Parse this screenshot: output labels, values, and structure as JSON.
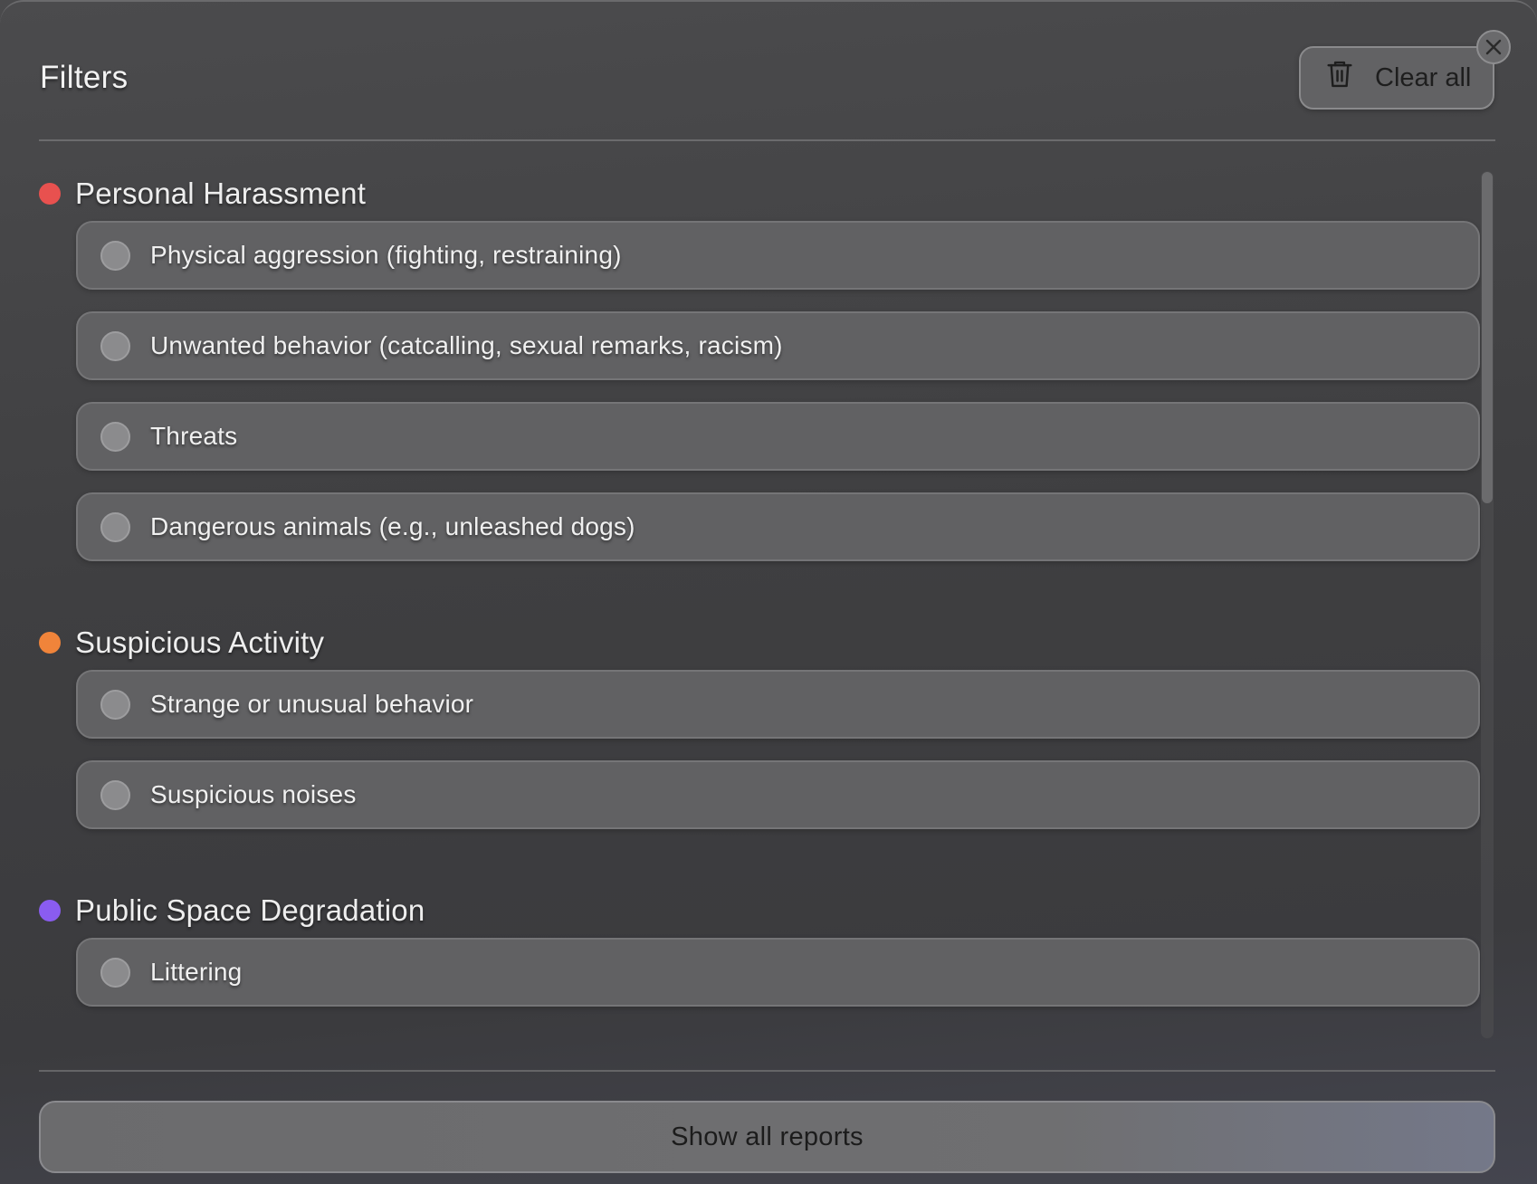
{
  "header": {
    "title": "Filters",
    "clear_all_label": "Clear all"
  },
  "sections": [
    {
      "title": "Personal Harassment",
      "color": "#e8514f",
      "options": [
        "Physical aggression (fighting, restraining)",
        "Unwanted behavior (catcalling, sexual remarks, racism)",
        "Threats",
        "Dangerous animals (e.g., unleashed dogs)"
      ]
    },
    {
      "title": "Suspicious Activity",
      "color": "#f0843a",
      "options": [
        "Strange or unusual behavior",
        "Suspicious noises"
      ]
    },
    {
      "title": "Public Space Degradation",
      "color": "#8a5cf0",
      "options": [
        "Littering"
      ]
    }
  ],
  "footer": {
    "show_all_label": "Show all reports"
  },
  "icons": {
    "clear": "trash-icon",
    "close": "close-icon"
  }
}
